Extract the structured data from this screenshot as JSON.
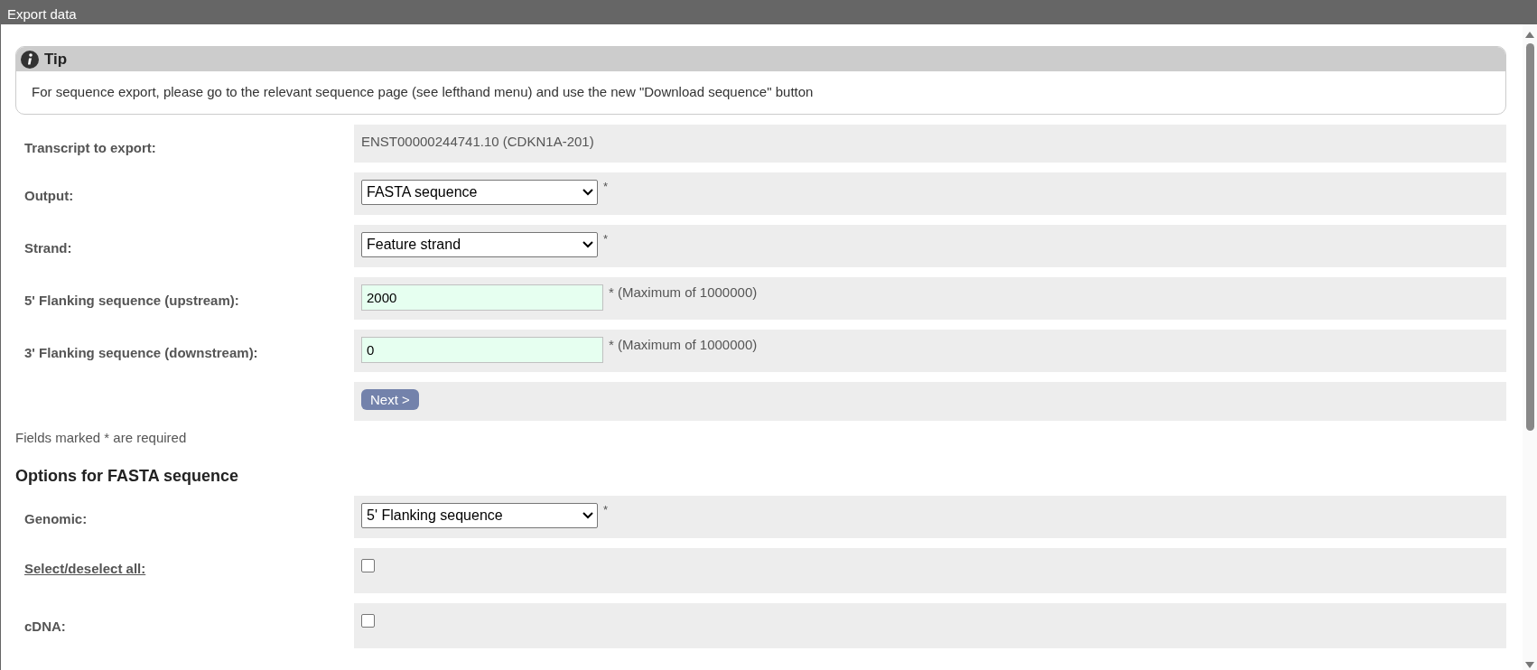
{
  "window": {
    "title": "Export data"
  },
  "tip": {
    "title": "Tip",
    "text": "For sequence export, please go to the relevant sequence page (see lefthand menu) and use the new \"Download sequence\" button"
  },
  "form": [
    {
      "kind": "text",
      "label": "Transcript to export:",
      "value": "ENST00000244741.10 (CDKN1A-201)"
    },
    {
      "kind": "select",
      "label": "Output:",
      "value": "FASTA sequence",
      "required": "*"
    },
    {
      "kind": "select",
      "label": "Strand:",
      "value": "Feature strand",
      "required": "*"
    },
    {
      "kind": "input",
      "label": "5' Flanking sequence (upstream):",
      "value": "2000",
      "note": "* (Maximum of 1000000)"
    },
    {
      "kind": "input",
      "label": "3' Flanking sequence (downstream):",
      "value": "0",
      "note": "* (Maximum of 1000000)"
    },
    {
      "kind": "button",
      "value": "Next >"
    }
  ],
  "required_note": "Fields marked * are required",
  "options": {
    "heading": "Options for FASTA sequence",
    "rows": [
      {
        "kind": "select",
        "label": "Genomic:",
        "value": "5' Flanking sequence",
        "required": "*"
      },
      {
        "kind": "checkbox",
        "label": "Select/deselect all:",
        "link": true,
        "checked": false
      },
      {
        "kind": "checkbox",
        "label": "cDNA:",
        "link": false,
        "checked": false
      }
    ]
  }
}
